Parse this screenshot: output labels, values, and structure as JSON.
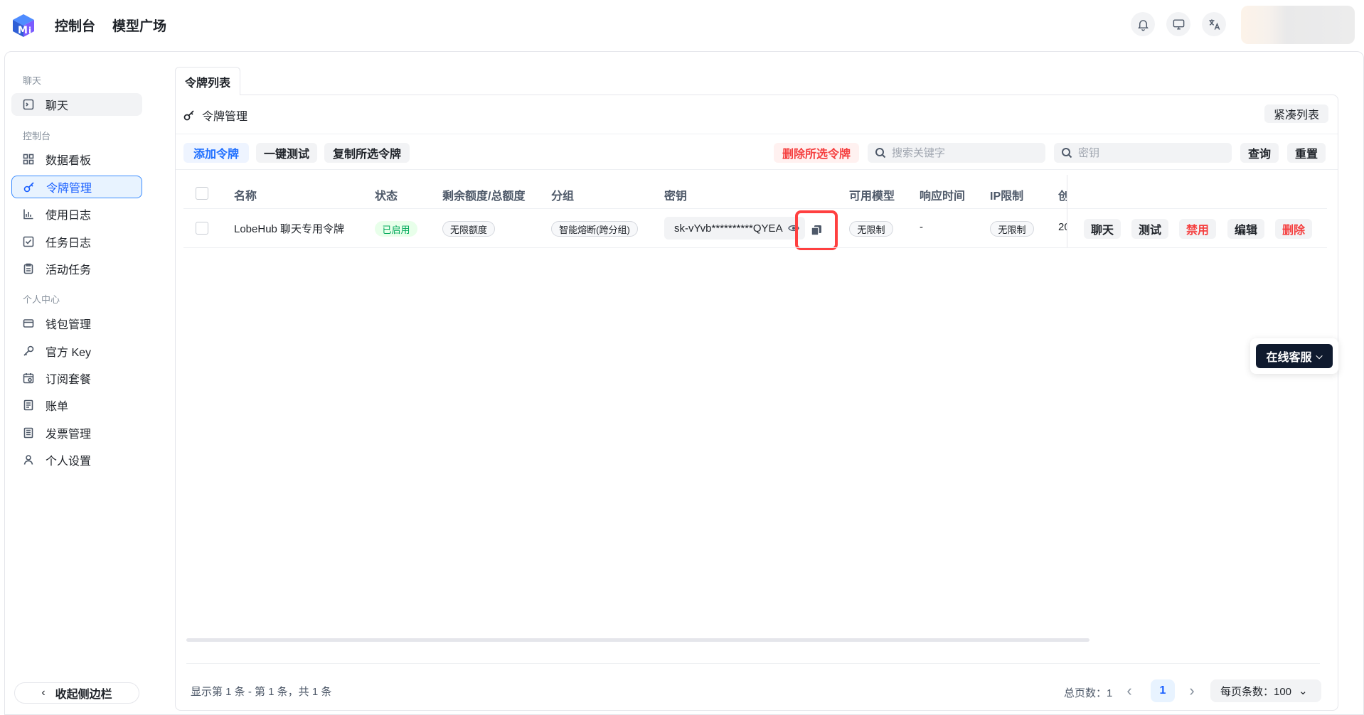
{
  "header": {
    "nav": [
      "控制台",
      "模型广场"
    ],
    "icons": [
      "bell-icon",
      "monitor-icon",
      "translate-icon"
    ]
  },
  "sidebar": {
    "groups": {
      "chat": "聊天",
      "console": "控制台",
      "personal": "个人中心"
    },
    "items": [
      {
        "label": "聊天",
        "icon": "chat-icon"
      },
      {
        "label": "数据看板",
        "icon": "dashboard-icon"
      },
      {
        "label": "令牌管理",
        "icon": "key-icon"
      },
      {
        "label": "使用日志",
        "icon": "chart-icon"
      },
      {
        "label": "任务日志",
        "icon": "checklist-icon"
      },
      {
        "label": "活动任务",
        "icon": "clipboard-icon"
      },
      {
        "label": "钱包管理",
        "icon": "wallet-icon"
      },
      {
        "label": "官方 Key",
        "icon": "key-outline-icon"
      },
      {
        "label": "订阅套餐",
        "icon": "calendar-icon"
      },
      {
        "label": "账单",
        "icon": "bill-icon"
      },
      {
        "label": "发票管理",
        "icon": "invoice-icon"
      },
      {
        "label": "个人设置",
        "icon": "user-icon"
      }
    ],
    "collapse_label": "收起侧边栏"
  },
  "main": {
    "tab": "令牌列表",
    "card_title": "令牌管理",
    "compact_label": "紧凑列表",
    "toolbar": {
      "add": "添加令牌",
      "test_all": "一键测试",
      "copy_selected": "复制所选令牌",
      "delete_selected": "删除所选令牌",
      "search_placeholder": "搜索关键字",
      "key_placeholder": "密钥",
      "query": "查询",
      "reset": "重置"
    },
    "columns": [
      "名称",
      "状态",
      "剩余额度/总额度",
      "分组",
      "密钥",
      "可用模型",
      "响应时间",
      "IP限制",
      "创"
    ],
    "rows": [
      {
        "name": "LobeHub 聊天专用令牌",
        "status": "已启用",
        "quota": "无限额度",
        "group": "智能熔断(跨分组)",
        "key": "sk-vYvb**********QYEA",
        "models": "无限制",
        "response_time": "-",
        "ip_limit": "无限制",
        "created": "20",
        "actions": [
          "聊天",
          "测试",
          "禁用",
          "编辑",
          "删除"
        ]
      }
    ],
    "footer": {
      "summary": "显示第 1 条 - 第 1 条，共 1 条",
      "total_pages": "总页数：1",
      "current_page": "1",
      "page_size": "每页条数：100"
    }
  },
  "support": {
    "label": "在线客服"
  },
  "colors": {
    "accent": "#165dff",
    "danger": "#f53f3f",
    "success": "#00a85a",
    "highlight": "#ff4040"
  }
}
